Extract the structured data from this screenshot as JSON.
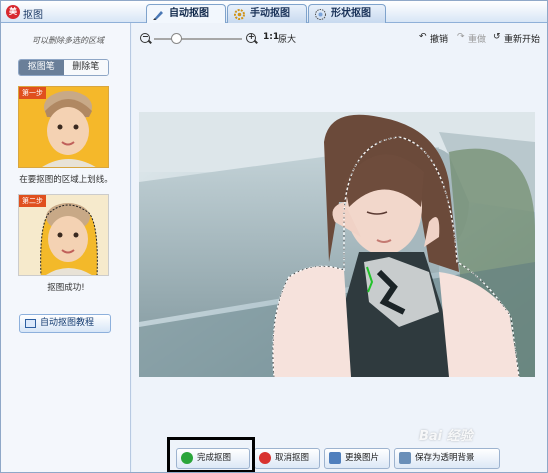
{
  "titlebar": {
    "title": "抠图",
    "icon": "app-logo-icon"
  },
  "tabs": [
    {
      "label": "自动抠图",
      "active": true,
      "icon": "brush-icon"
    },
    {
      "label": "手动抠图",
      "active": false,
      "icon": "gear-icon"
    },
    {
      "label": "形状抠图",
      "active": false,
      "icon": "shape-icon"
    }
  ],
  "sidebar": {
    "hint": "可以删除多选的区域",
    "toggle": {
      "pen": "抠图笔",
      "eraser": "删除笔"
    },
    "step1": {
      "badge": "第一步",
      "caption": "在要抠图的区域上划线。"
    },
    "step2": {
      "badge": "第二步",
      "caption": "抠图成功!"
    },
    "tutorial": "自动抠图教程"
  },
  "toolbar": {
    "zoom_out_symbol": "−",
    "zoom_in_symbol": "+",
    "ratio_label": "1:1",
    "original_label": "原大",
    "undo": "撤销",
    "redo": "重做",
    "restart": "重新开始",
    "zoom_level": 0.25
  },
  "actions": {
    "finish": "完成抠图",
    "cancel": "取消抠图",
    "replace": "更换图片",
    "save": "保存为透明背景"
  },
  "watermark": "Bai 经验",
  "colors": {
    "accent": "#2f6fb5",
    "selection_line": "#22c22a",
    "finish_icon": "#2aa53a",
    "cancel_icon": "#d8322f"
  }
}
